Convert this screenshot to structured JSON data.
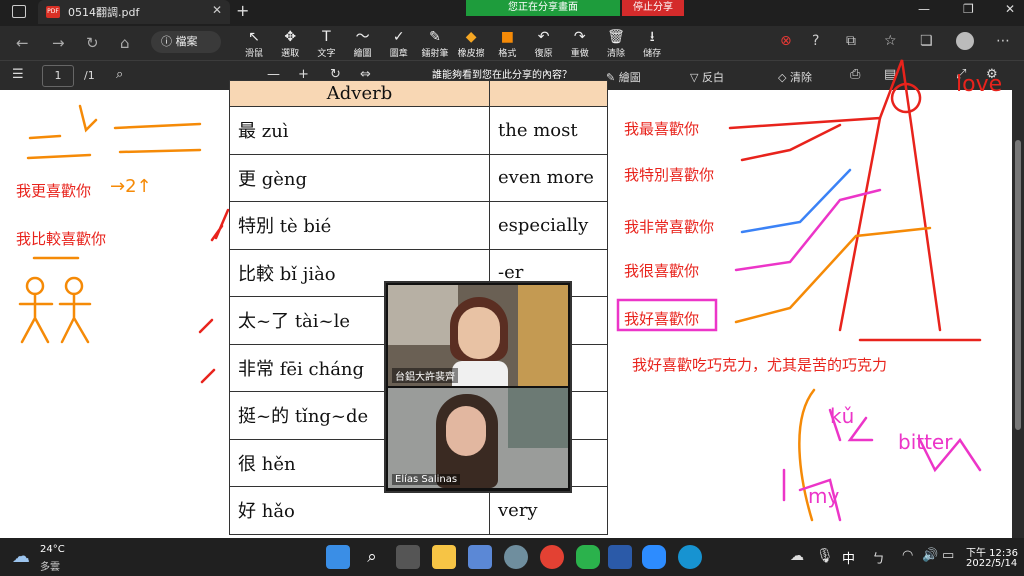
{
  "browser": {
    "tab_title": "0514翻調.pdf",
    "new_tab": "+",
    "share_status": "您正在分享畫面",
    "stop_share": "停止分享",
    "window_controls": [
      "—",
      "❐",
      "✕"
    ]
  },
  "toolbar": {
    "address_label": "檔案",
    "tools": [
      {
        "label": "滑鼠",
        "icon": "↖"
      },
      {
        "label": "選取",
        "icon": "✥"
      },
      {
        "label": "文字",
        "icon": "T"
      },
      {
        "label": "繪圖",
        "icon": "〜"
      },
      {
        "label": "圖章",
        "icon": "✓"
      },
      {
        "label": "鐳射筆",
        "icon": "✎"
      },
      {
        "label": "橡皮擦",
        "icon": "◆"
      },
      {
        "label": "格式",
        "icon": "■"
      },
      {
        "label": "復原",
        "icon": "↶"
      },
      {
        "label": "重做",
        "icon": "↷"
      },
      {
        "label": "清除",
        "icon": "🗑"
      },
      {
        "label": "儲存",
        "icon": "⭳"
      }
    ]
  },
  "pdf_toolbar": {
    "page_number": "1",
    "page_total": "/1",
    "share_hint": "誰能夠看到您在此分享的內容？",
    "draw_label": "繪圖",
    "highlight_label": "反白",
    "erase_label": "清除"
  },
  "document": {
    "header": "Adverb",
    "rows": [
      {
        "hanzi": "最",
        "pinyin": "zuì",
        "english": "the most"
      },
      {
        "hanzi": "更",
        "pinyin": "gèng",
        "english": "even more"
      },
      {
        "hanzi": "特別",
        "pinyin": "tè bié",
        "english": "especially"
      },
      {
        "hanzi": "比較",
        "pinyin": "bǐ jiào",
        "english": "-er"
      },
      {
        "hanzi": "太~了",
        "pinyin": "tài~le",
        "english": ""
      },
      {
        "hanzi": "非常",
        "pinyin": "fēi cháng",
        "english": ""
      },
      {
        "hanzi": "挺~的",
        "pinyin": "tǐng~de",
        "english": ""
      },
      {
        "hanzi": "很",
        "pinyin": "hěn",
        "english": ""
      },
      {
        "hanzi": "好",
        "pinyin": "hǎo",
        "english": "very"
      }
    ]
  },
  "annotations": {
    "left": [
      "我更喜歡你",
      "我比較喜歡你"
    ],
    "right": [
      "我最喜歡你",
      "我特別喜歡你",
      "我非常喜歡你",
      "我很喜歡你",
      "我好喜歡你"
    ],
    "sentence": "我好喜歡吃巧克力，尤其是苦的巧克力",
    "handwriting": [
      "love",
      "kǔ",
      "bitter",
      "my"
    ],
    "left_note": "→2↑"
  },
  "video": {
    "participant1": "台鋁大許裴齊",
    "participant2": "Elías Salinas"
  },
  "taskbar": {
    "weather_temp": "24°C",
    "weather_desc": "多雲",
    "ime": "中",
    "time": "下午 12:36",
    "date": "2022/5/14"
  }
}
